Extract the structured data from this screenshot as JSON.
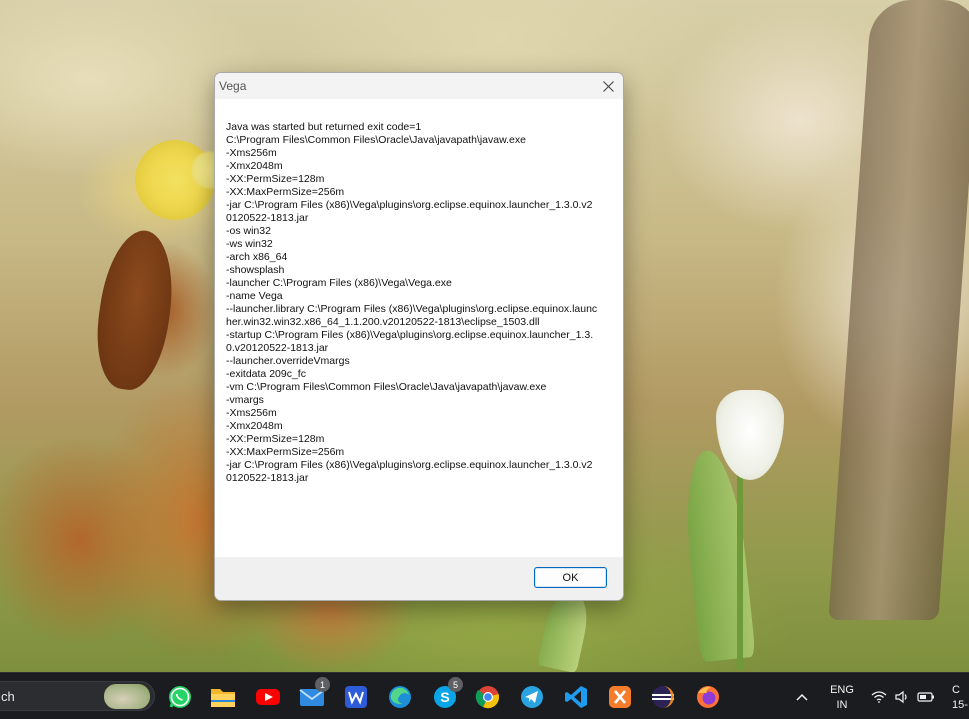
{
  "dialog": {
    "title": "Vega",
    "message": "Java was started but returned exit code=1\nC:\\Program Files\\Common Files\\Oracle\\Java\\javapath\\javaw.exe\n-Xms256m\n-Xmx2048m\n-XX:PermSize=128m\n-XX:MaxPermSize=256m\n-jar C:\\Program Files (x86)\\Vega\\plugins\\org.eclipse.equinox.launcher_1.3.0.v20120522-1813.jar\n-os win32\n-ws win32\n-arch x86_64\n-showsplash\n-launcher C:\\Program Files (x86)\\Vega\\Vega.exe\n-name Vega\n--launcher.library C:\\Program Files (x86)\\Vega\\plugins\\org.eclipse.equinox.launcher.win32.win32.x86_64_1.1.200.v20120522-1813\\eclipse_1503.dll\n-startup C:\\Program Files (x86)\\Vega\\plugins\\org.eclipse.equinox.launcher_1.3.0.v20120522-1813.jar\n--launcher.overrideVmargs\n-exitdata 209c_fc\n-vm C:\\Program Files\\Common Files\\Oracle\\Java\\javapath\\javaw.exe\n-vmargs\n-Xms256m\n-Xmx2048m\n-XX:PermSize=128m\n-XX:MaxPermSize=256m\n-jar C:\\Program Files (x86)\\Vega\\plugins\\org.eclipse.equinox.launcher_1.3.0.v20120522-1813.jar",
    "ok_label": "OK",
    "close_icon": "close-icon"
  },
  "taskbar": {
    "search_text": "ch",
    "apps": [
      {
        "name": "whatsapp",
        "badge": ""
      },
      {
        "name": "file-explorer",
        "badge": ""
      },
      {
        "name": "youtube",
        "badge": ""
      },
      {
        "name": "mail",
        "badge": "1"
      },
      {
        "name": "wps-writer",
        "badge": ""
      },
      {
        "name": "edge",
        "badge": ""
      },
      {
        "name": "skype",
        "badge": "5"
      },
      {
        "name": "chrome",
        "badge": ""
      },
      {
        "name": "telegram",
        "badge": ""
      },
      {
        "name": "vscode",
        "badge": ""
      },
      {
        "name": "xampp",
        "badge": ""
      },
      {
        "name": "eclipse",
        "badge": ""
      },
      {
        "name": "firefox",
        "badge": ""
      }
    ],
    "language_line1": "ENG",
    "language_line2": "IN",
    "clock_line1": "C",
    "clock_line2": "15-"
  },
  "colors": {
    "accent": "#0067c0",
    "taskbar_bg": "#1b1c1f",
    "dialog_footer": "#f0f0f0"
  }
}
